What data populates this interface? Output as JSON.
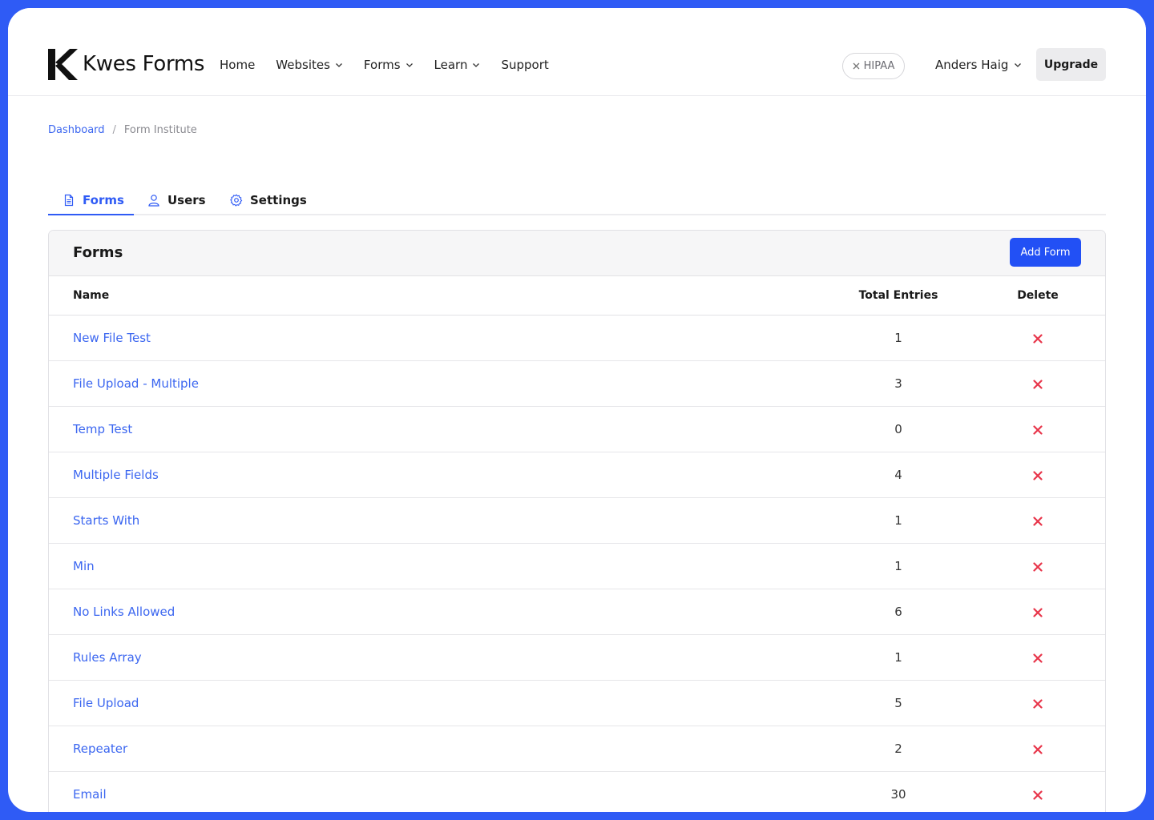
{
  "brand": {
    "name": "Kwes Forms"
  },
  "nav": {
    "items": [
      {
        "label": "Home",
        "dropdown": false
      },
      {
        "label": "Websites",
        "dropdown": true
      },
      {
        "label": "Forms",
        "dropdown": true
      },
      {
        "label": "Learn",
        "dropdown": true
      },
      {
        "label": "Support",
        "dropdown": false
      }
    ]
  },
  "hipaa_badge": "HIPAA",
  "user": {
    "name": "Anders Haig"
  },
  "upgrade_label": "Upgrade",
  "breadcrumb": {
    "home": "Dashboard",
    "separator": "/",
    "current": "Form Institute"
  },
  "tabs": [
    {
      "label": "Forms",
      "icon": "document-icon",
      "active": true
    },
    {
      "label": "Users",
      "icon": "user-icon",
      "active": false
    },
    {
      "label": "Settings",
      "icon": "gear-icon",
      "active": false
    }
  ],
  "panel": {
    "title": "Forms",
    "add_button": "Add Form"
  },
  "table": {
    "columns": [
      "Name",
      "Total Entries",
      "Delete"
    ],
    "rows": [
      {
        "name": "New File Test",
        "entries": "1"
      },
      {
        "name": "File Upload - Multiple",
        "entries": "3"
      },
      {
        "name": "Temp Test",
        "entries": "0"
      },
      {
        "name": "Multiple Fields",
        "entries": "4"
      },
      {
        "name": "Starts With",
        "entries": "1"
      },
      {
        "name": "Min",
        "entries": "1"
      },
      {
        "name": "No Links Allowed",
        "entries": "6"
      },
      {
        "name": "Rules Array",
        "entries": "1"
      },
      {
        "name": "File Upload",
        "entries": "5"
      },
      {
        "name": "Repeater",
        "entries": "2"
      },
      {
        "name": "Email",
        "entries": "30"
      }
    ]
  },
  "colors": {
    "accent": "#2f5bf5",
    "link": "#3b66f0",
    "delete": "#e8354a",
    "frame_border": "#2f5bf5"
  }
}
